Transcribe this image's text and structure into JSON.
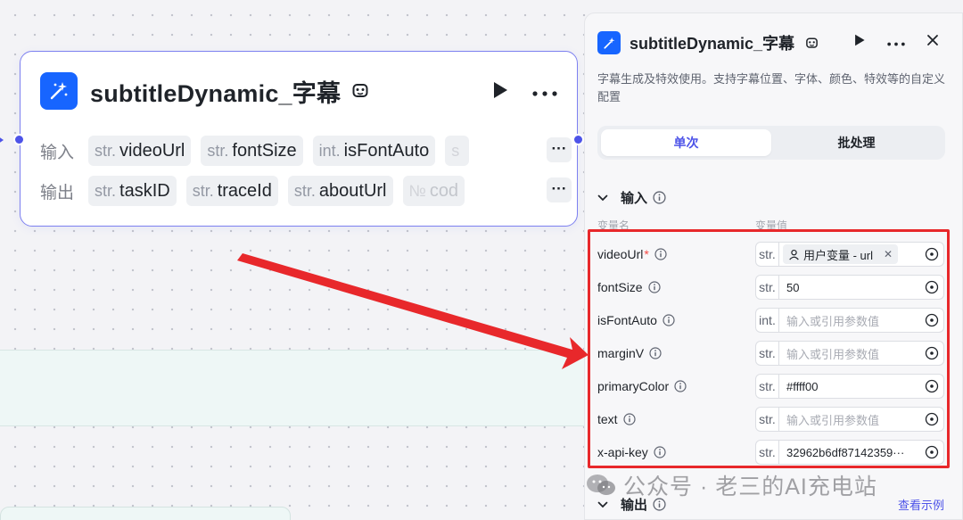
{
  "node": {
    "title": "subtitleDynamic_字幕",
    "input_label": "输入",
    "output_label": "输出",
    "inputs": [
      {
        "type": "str.",
        "name": "videoUrl"
      },
      {
        "type": "str.",
        "name": "fontSize"
      },
      {
        "type": "int.",
        "name": "isFontAuto"
      },
      {
        "type": "s",
        "name": ""
      }
    ],
    "outputs": [
      {
        "type": "str.",
        "name": "taskID"
      },
      {
        "type": "str.",
        "name": "traceId"
      },
      {
        "type": "str.",
        "name": "aboutUrl"
      },
      {
        "type": "№",
        "name": "cod"
      }
    ],
    "more_label": "···"
  },
  "panel": {
    "title": "subtitleDynamic_字幕",
    "description": "字幕生成及特效使用。支持字幕位置、字体、颜色、特效等的自定义配置",
    "tabs": [
      "单次",
      "批处理"
    ],
    "input_section": "输入",
    "col_name": "变量名",
    "col_value": "变量值",
    "params": [
      {
        "name": "videoUrl",
        "required": "*",
        "type": "str.",
        "ref": "用户变量 - url",
        "value": "",
        "placeholder": ""
      },
      {
        "name": "fontSize",
        "required": "",
        "type": "str.",
        "ref": "",
        "value": "50",
        "placeholder": ""
      },
      {
        "name": "isFontAuto",
        "required": "",
        "type": "int.",
        "ref": "",
        "value": "",
        "placeholder": "输入或引用参数值"
      },
      {
        "name": "marginV",
        "required": "",
        "type": "str.",
        "ref": "",
        "value": "",
        "placeholder": "输入或引用参数值"
      },
      {
        "name": "primaryColor",
        "required": "",
        "type": "str.",
        "ref": "",
        "value": "#ffff00",
        "placeholder": ""
      },
      {
        "name": "text",
        "required": "",
        "type": "str.",
        "ref": "",
        "value": "",
        "placeholder": "输入或引用参数值"
      },
      {
        "name": "x-api-key",
        "required": "",
        "type": "str.",
        "ref": "",
        "value": "32962b6df87142359···",
        "placeholder": ""
      }
    ],
    "output_section": "输出",
    "example_link": "查看示例",
    "more_label": "···",
    "close_label": "✕"
  },
  "watermark": "公众号 · 老三的AI充电站",
  "colors": {
    "accent": "#4d53e8",
    "brand_icon": "#1765ff",
    "highlight_red": "#e8282b"
  }
}
